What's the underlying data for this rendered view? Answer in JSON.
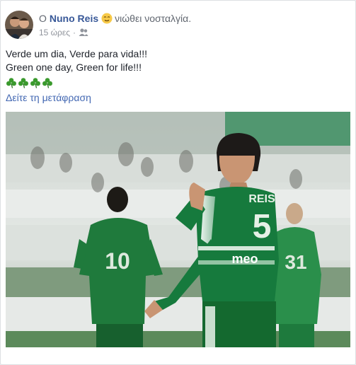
{
  "post": {
    "author_prefix": "Ο",
    "author": "Nuno Reis",
    "feeling": "νιώθει νοσταλγία.",
    "time": "15 ώρες",
    "separator": "·",
    "audience_icon": "friends-icon",
    "feeling_icon": "nostalgic-emoji-icon",
    "text_line_1": "Verde um dia, Verde para vida!!!",
    "text_line_2": "Green one day, Green for life!!!",
    "clover_count": 4,
    "clover_icon": "shamrock-icon",
    "translate_link": "Δείτε τη μετάφραση"
  },
  "photo": {
    "player_main_name": "REIS",
    "player_main_number": "5",
    "sponsor": "meo",
    "player_left_number": "10",
    "player_right_number": "31"
  },
  "colors": {
    "link": "#385898",
    "translate": "#4267b2",
    "jersey_green": "#167a3d",
    "text_secondary": "#90949c"
  }
}
